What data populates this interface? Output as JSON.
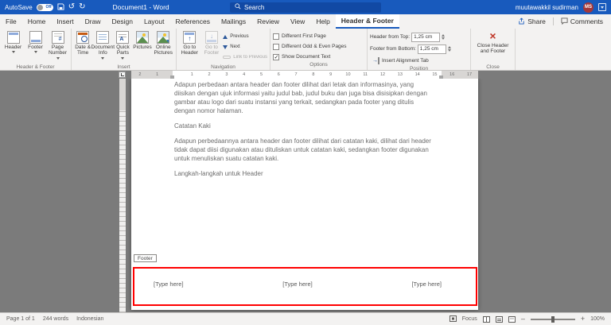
{
  "titlebar": {
    "autosave_label": "AutoSave",
    "autosave_state": "Off",
    "title": "Document1 - Word",
    "search_placeholder": "Search",
    "user_name": "muutawakkil sudirman",
    "user_initials": "MS"
  },
  "tabs": {
    "items": [
      "File",
      "Home",
      "Insert",
      "Draw",
      "Design",
      "Layout",
      "References",
      "Mailings",
      "Review",
      "View",
      "Help"
    ],
    "active_tab": "Header & Footer",
    "share_label": "Share",
    "comments_label": "Comments"
  },
  "ribbon": {
    "header_footer_group": {
      "name": "Header & Footer",
      "header_button": "Header",
      "footer_button": "Footer",
      "page_number_button": "Page Number"
    },
    "insert_group": {
      "name": "Insert",
      "date_time": "Date & Time",
      "document_info": "Document Info",
      "quick_parts": "Quick Parts",
      "pictures": "Pictures",
      "online_pictures": "Online Pictures"
    },
    "navigation_group": {
      "name": "Navigation",
      "go_to_header": "Go to Header",
      "go_to_footer": "Go to Footer",
      "previous": "Previous",
      "next": "Next",
      "link_to_previous": "Link to Previous"
    },
    "options_group": {
      "name": "Options",
      "different_first_page": "Different First Page",
      "different_odd_even": "Different Odd & Even Pages",
      "show_document_text": "Show Document Text",
      "show_document_text_checked": true
    },
    "position_group": {
      "name": "Position",
      "header_from_top_label": "Header from Top:",
      "header_from_top_value": "1,25 cm",
      "footer_from_bottom_label": "Footer from Bottom:",
      "footer_from_bottom_value": "1,25 cm",
      "insert_alignment_tab": "Insert Alignment Tab"
    },
    "close_group": {
      "name": "Close",
      "close_button": "Close Header and Footer"
    }
  },
  "ruler": {
    "h_numbers": [
      "2",
      "1",
      "",
      "1",
      "2",
      "3",
      "4",
      "5",
      "6",
      "7",
      "8",
      "9",
      "10",
      "11",
      "12",
      "13",
      "14",
      "15",
      "16",
      "17"
    ]
  },
  "document": {
    "paragraph1": "Adapun perbedaan antara header dan footer dilihat dari letak dan informasinya, yang diisikan dengan ujuk informasi yaitu judul bab, judul buku dan juga bisa disisipkan dengan gambar atau logo dari suatu instansi yang terkait, sedangkan pada footer yang ditulis dengan nomor halaman.",
    "heading1": "Catatan Kaki",
    "paragraph2": "Adapun perbedaannya antara header dan footer dilihat dari catatan kaki, dilihat dari header tidak dapat diisi digunakan atau dituliskan untuk catatan kaki, sedangkan footer digunakan untuk menuliskan suatu catatan kaki.",
    "heading2": "Langkah-langkah untuk Header",
    "footer_tab_label": "Footer",
    "footer_placeholders": [
      "[Type here]",
      "[Type here]",
      "[Type here]"
    ]
  },
  "statusbar": {
    "page_indicator": "Page 1 of 1",
    "word_count": "244 words",
    "language": "Indonesian",
    "focus_label": "Focus",
    "zoom_level": "100%"
  },
  "colors": {
    "accent": "#185abd",
    "titlebar_bg": "#185abd",
    "avatar_bg": "#a4373a",
    "annotation_red": "#ff0000",
    "canvas_bg": "#7b7b7b"
  }
}
